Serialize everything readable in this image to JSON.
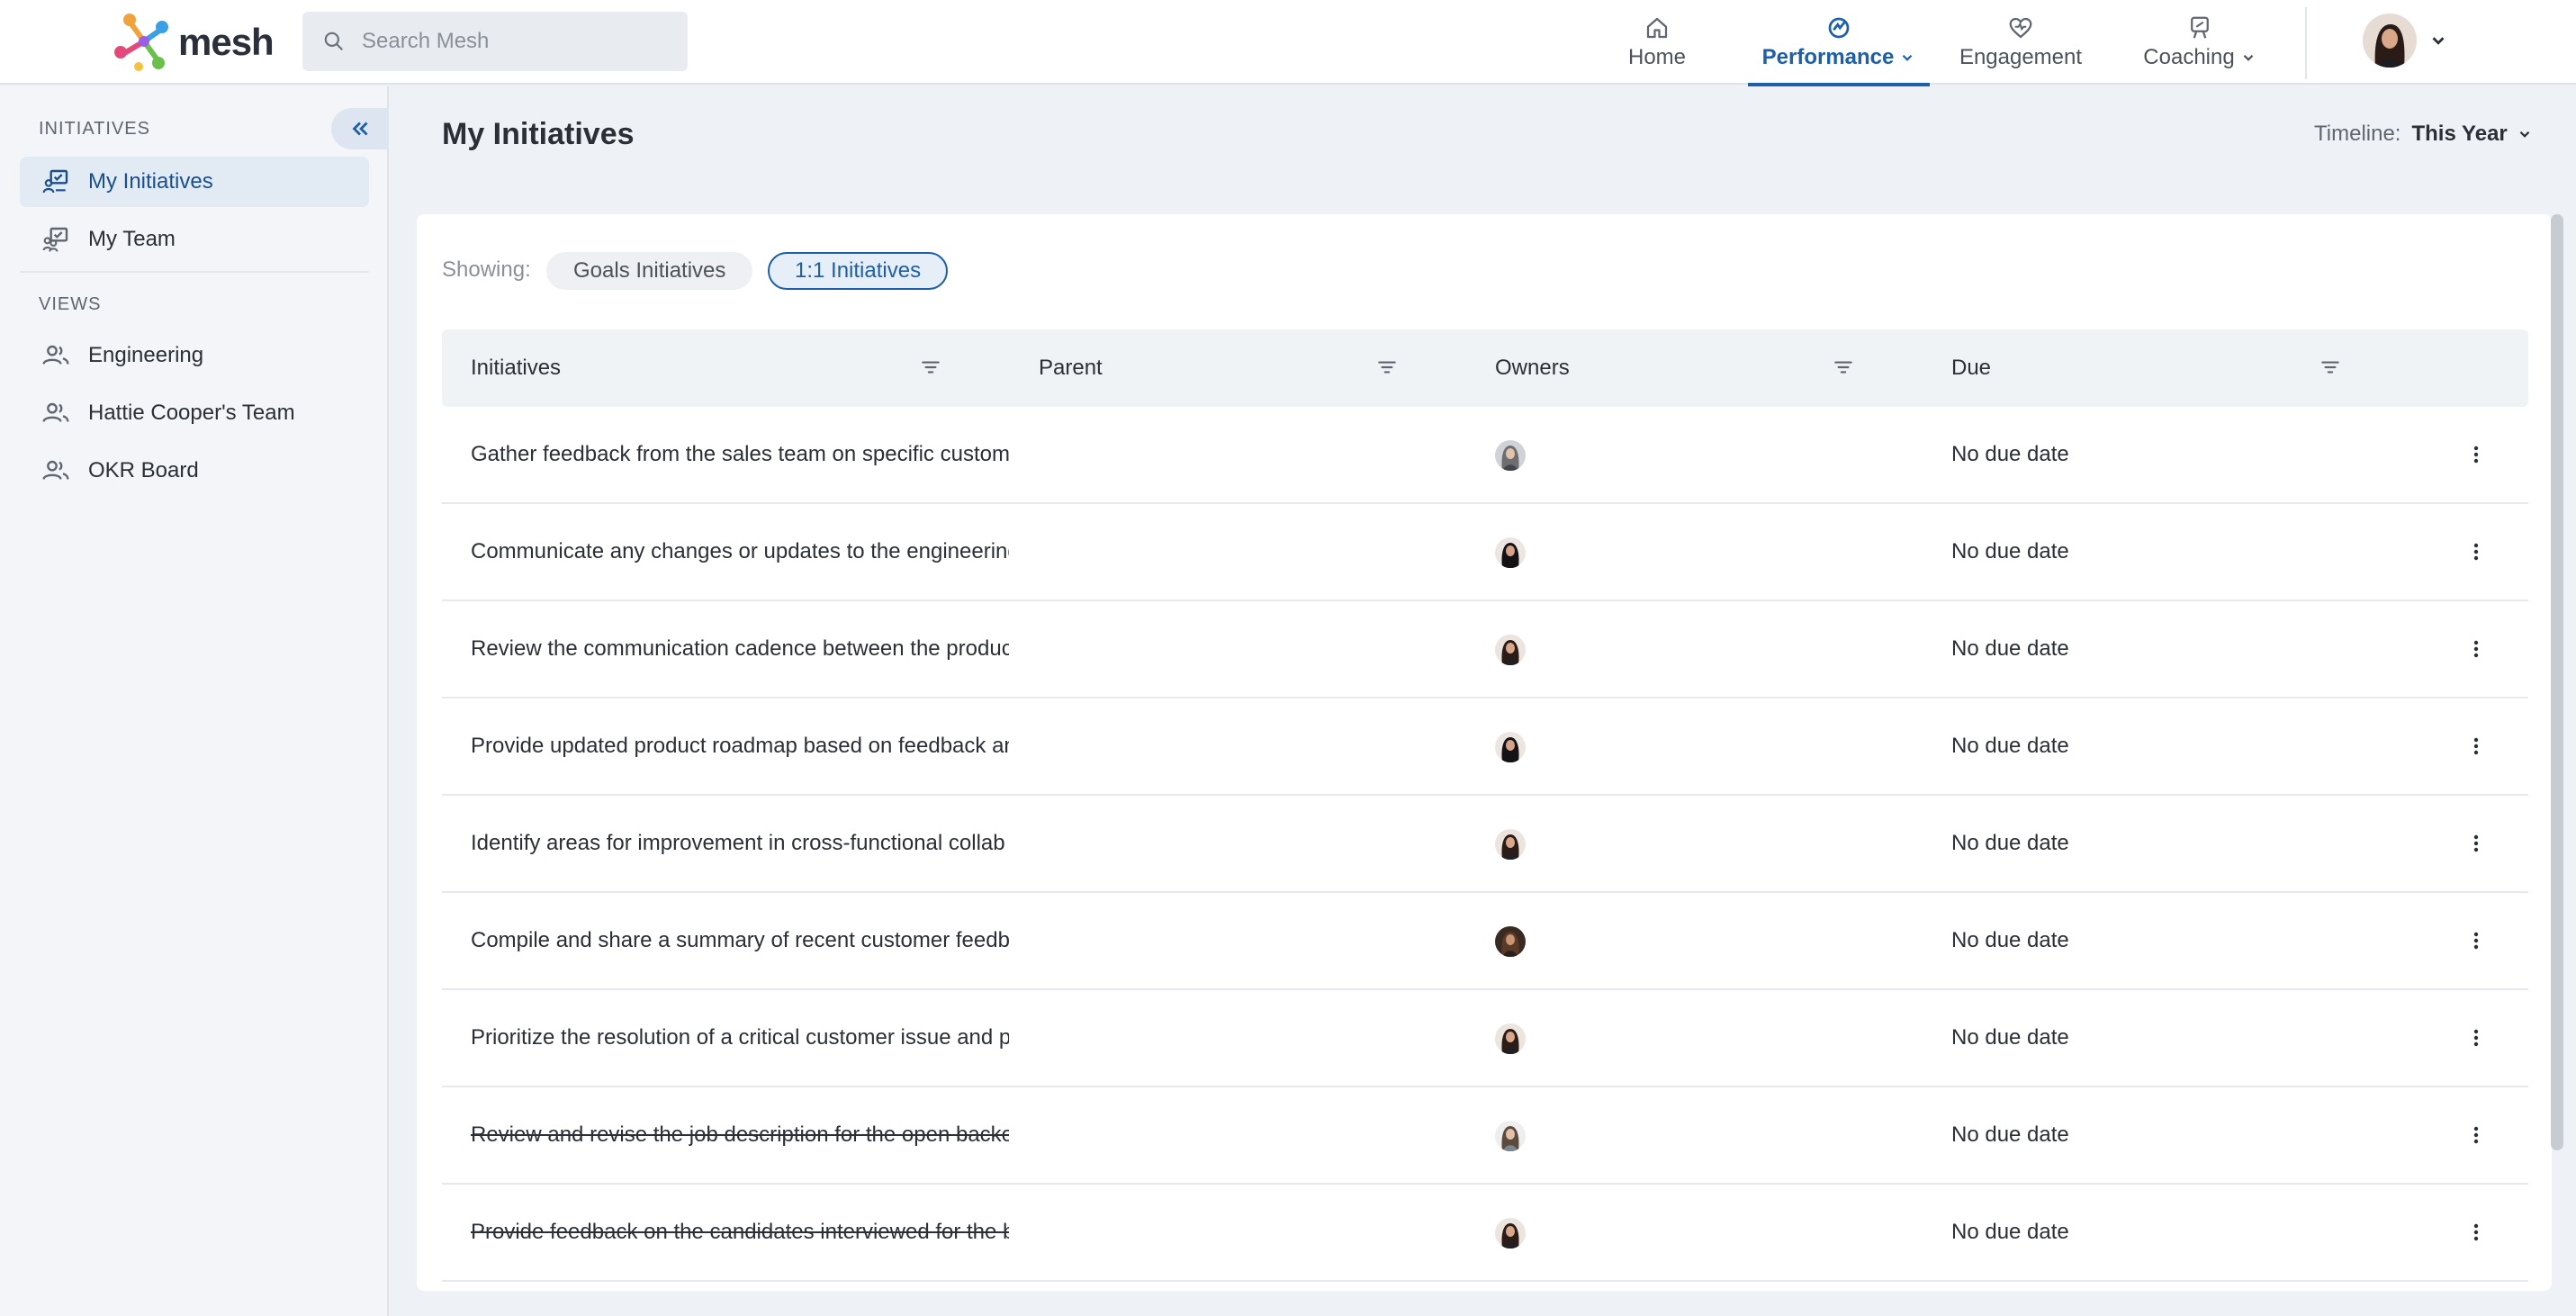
{
  "brand": {
    "name": "mesh"
  },
  "search": {
    "placeholder": "Search Mesh"
  },
  "nav": {
    "home": "Home",
    "performance": "Performance",
    "engagement": "Engagement",
    "coaching": "Coaching"
  },
  "sidebar": {
    "section_initiatives": "INITIATIVES",
    "section_views": "VIEWS",
    "initiatives_items": [
      {
        "label": "My Initiatives",
        "icon": "initiatives-icon",
        "active": true
      },
      {
        "label": "My Team",
        "icon": "team-initiatives-icon",
        "active": false
      }
    ],
    "views_items": [
      {
        "label": "Engineering",
        "icon": "people-icon"
      },
      {
        "label": "Hattie Cooper's Team",
        "icon": "people-icon"
      },
      {
        "label": "OKR Board",
        "icon": "people-icon"
      }
    ]
  },
  "page": {
    "title": "My Initiatives",
    "timeline_label": "Timeline:",
    "timeline_value": "This Year"
  },
  "filters": {
    "showing_label": "Showing:",
    "pills": [
      {
        "label": "Goals Initiatives",
        "selected": false
      },
      {
        "label": "1:1 Initiatives",
        "selected": true
      }
    ]
  },
  "table": {
    "columns": [
      "Initiatives",
      "Parent",
      "Owners",
      "Due"
    ],
    "rows": [
      {
        "initiative": "Gather feedback from the sales team on specific custome",
        "parent": "",
        "owner_avatar": "avatar-gray-man",
        "due": "No due date",
        "completed": false
      },
      {
        "initiative": "Communicate any changes or updates to the engineering",
        "parent": "",
        "owner_avatar": "avatar-dark-woman",
        "due": "No due date",
        "completed": false
      },
      {
        "initiative": "Review the communication cadence between the produc",
        "parent": "",
        "owner_avatar": "avatar-woman",
        "due": "No due date",
        "completed": false
      },
      {
        "initiative": "Provide updated product roadmap based on feedback an",
        "parent": "",
        "owner_avatar": "avatar-dark-woman",
        "due": "No due date",
        "completed": false
      },
      {
        "initiative": "Identify areas for improvement in cross-functional collab",
        "parent": "",
        "owner_avatar": "avatar-woman",
        "due": "No due date",
        "completed": false
      },
      {
        "initiative": "Compile and share a summary of recent customer feedba",
        "parent": "",
        "owner_avatar": "avatar-brown-woman",
        "due": "No due date",
        "completed": false
      },
      {
        "initiative": "Prioritize the resolution of a critical customer issue and p",
        "parent": "",
        "owner_avatar": "avatar-woman",
        "due": "No due date",
        "completed": false
      },
      {
        "initiative": "Review and revise the job description for the open backer",
        "parent": "",
        "owner_avatar": "avatar-man",
        "due": "No due date",
        "completed": true
      },
      {
        "initiative": "Provide feedback on the candidates interviewed for the b",
        "parent": "",
        "owner_avatar": "avatar-woman",
        "due": "No due date",
        "completed": true
      }
    ]
  },
  "colors": {
    "accent": "#1d5fa8",
    "sidebar_bg": "#f3f5f8",
    "active_item_bg": "#e2eaf4"
  }
}
